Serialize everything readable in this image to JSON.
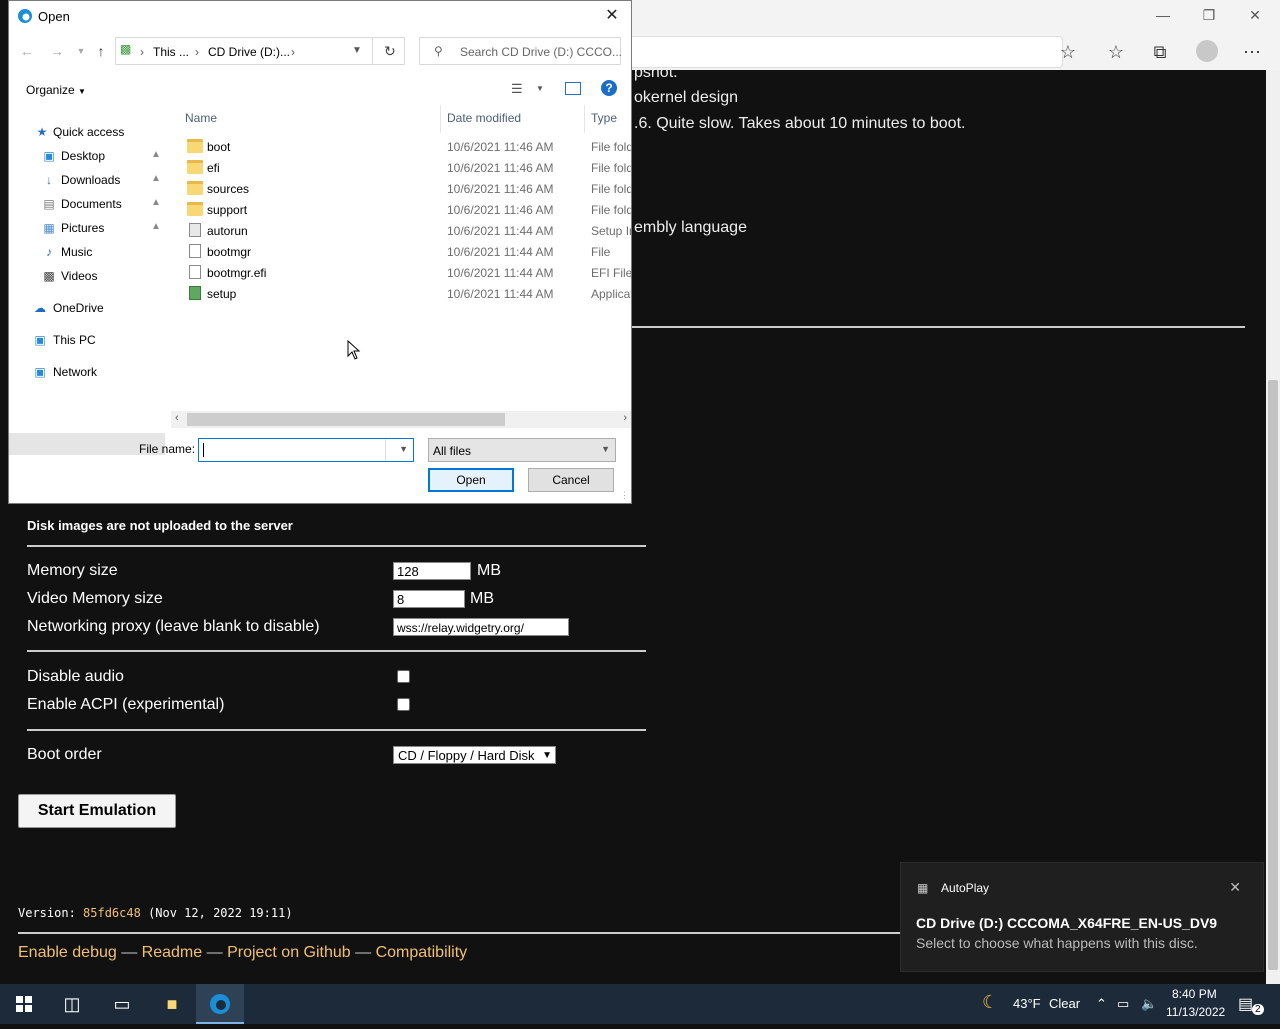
{
  "dialog": {
    "title": "Open",
    "breadcrumb": [
      "This ...",
      "CD Drive (D:)..."
    ],
    "search_placeholder": "Search CD Drive (D:) CCCO...",
    "organize": "Organize",
    "tree": [
      "Quick access",
      "Desktop",
      "Downloads",
      "Documents",
      "Pictures",
      "Music",
      "Videos",
      "OneDrive",
      "This PC",
      "Network"
    ],
    "columns": {
      "name": "Name",
      "date": "Date modified",
      "type": "Type"
    },
    "files": [
      {
        "name": "boot",
        "date": "10/6/2021 11:46 AM",
        "type": "File fold",
        "kind": "folder"
      },
      {
        "name": "efi",
        "date": "10/6/2021 11:46 AM",
        "type": "File fold",
        "kind": "folder"
      },
      {
        "name": "sources",
        "date": "10/6/2021 11:46 AM",
        "type": "File fold",
        "kind": "folder"
      },
      {
        "name": "support",
        "date": "10/6/2021 11:46 AM",
        "type": "File fold",
        "kind": "folder"
      },
      {
        "name": "autorun",
        "date": "10/6/2021 11:44 AM",
        "type": "Setup In",
        "kind": "setup"
      },
      {
        "name": "bootmgr",
        "date": "10/6/2021 11:44 AM",
        "type": "File",
        "kind": "file"
      },
      {
        "name": "bootmgr.efi",
        "date": "10/6/2021 11:44 AM",
        "type": "EFI File",
        "kind": "file"
      },
      {
        "name": "setup",
        "date": "10/6/2021 11:44 AM",
        "type": "Applicat",
        "kind": "app"
      }
    ],
    "file_name_label": "File name:",
    "file_name_value": "",
    "filter": "All files",
    "open_label": "Open",
    "cancel_label": "Cancel"
  },
  "page": {
    "bg_lines": [
      "pshot.",
      "okernel design",
      ".6. Quite slow. Takes about 10 minutes to boot.",
      "embly language"
    ],
    "disk_note": "Disk images are not uploaded to the server",
    "memory_label": "Memory size",
    "memory_value": "128",
    "vmem_label": "Video Memory size",
    "vmem_value": "8",
    "unit": "MB",
    "proxy_label": "Networking proxy (leave blank to disable)",
    "proxy_value": "wss://relay.widgetry.org/",
    "disable_audio": "Disable audio",
    "enable_acpi": "Enable ACPI (experimental)",
    "boot_order_label": "Boot order",
    "boot_order_value": "CD / Floppy / Hard Disk",
    "start": "Start Emulation",
    "version_prefix": "Version:",
    "version_hash": "85fd6c48",
    "version_date": "(Nov 12, 2022 19:11)",
    "footer": [
      "Enable debug",
      "Readme",
      "Project on Github",
      "Compatibility"
    ],
    "footer_sep": "—"
  },
  "toast": {
    "app": "AutoPlay",
    "title": "CD Drive (D:) CCCOMA_X64FRE_EN-US_DV9",
    "message": "Select to choose what happens with this disc."
  },
  "taskbar": {
    "weather_temp": "43°F",
    "weather_cond": "Clear",
    "time": "8:40 PM",
    "date": "11/13/2022",
    "notif_count": "2"
  },
  "colors": {
    "accent": "#0078d7",
    "link": "#f0c070",
    "taskbar": "#1c2a3a"
  }
}
